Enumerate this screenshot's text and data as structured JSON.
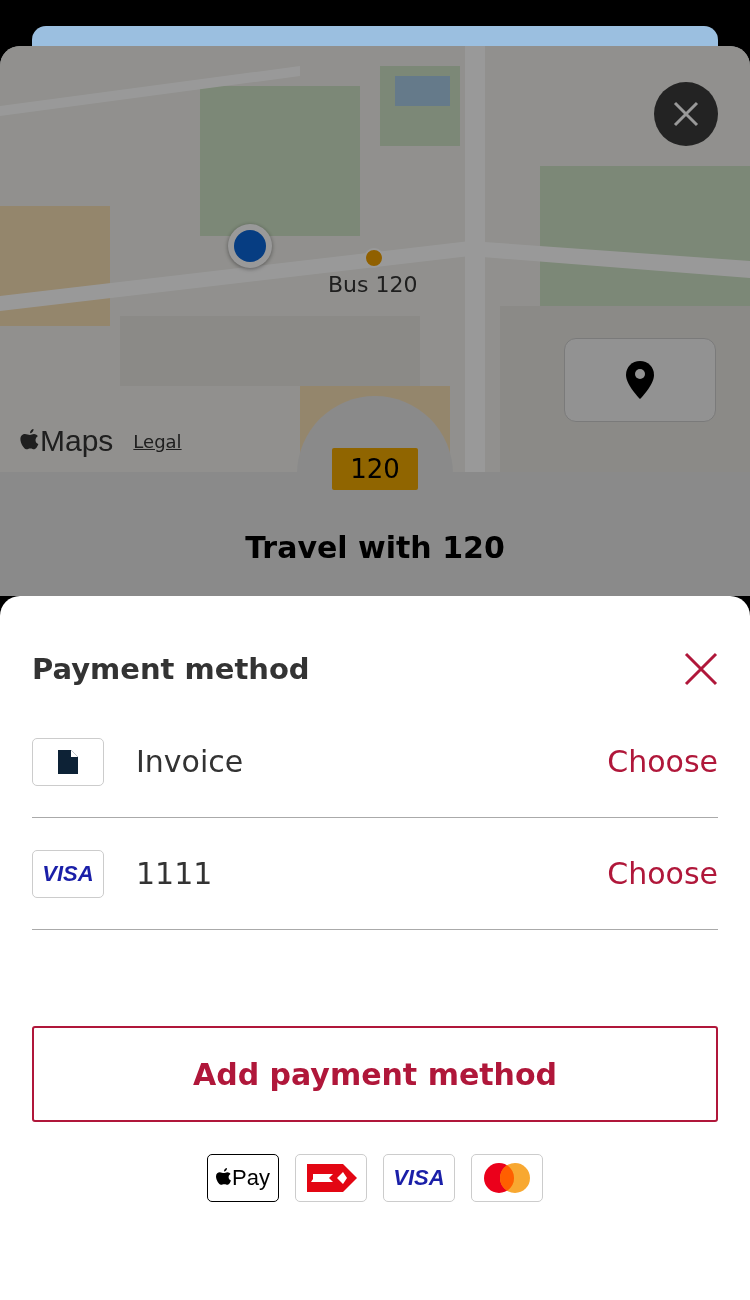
{
  "map": {
    "stop_label": "Bus 120",
    "attribution": "Maps",
    "legal_link": "Legal"
  },
  "route": {
    "badge": "120",
    "title": "Travel with 120"
  },
  "sheet": {
    "title": "Payment method",
    "methods": [
      {
        "kind": "invoice",
        "label": "Invoice",
        "action": "Choose"
      },
      {
        "kind": "visa",
        "logo_text": "VISA",
        "label": "1111",
        "action": "Choose"
      }
    ],
    "add_button": "Add payment method",
    "accepted": [
      {
        "kind": "applepay",
        "text": "Pay"
      },
      {
        "kind": "dankort"
      },
      {
        "kind": "visa",
        "text": "VISA"
      },
      {
        "kind": "mastercard"
      }
    ]
  }
}
